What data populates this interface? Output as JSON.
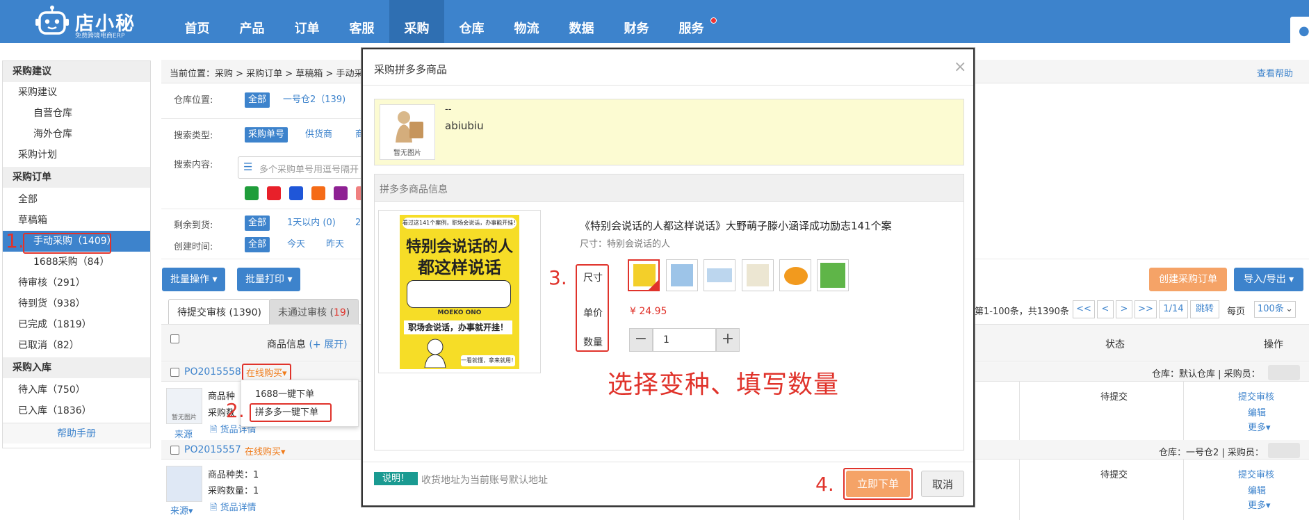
{
  "app": {
    "logo_text": "店小秘",
    "logo_sub": "免费跨境电商ERP"
  },
  "nav": [
    "首页",
    "产品",
    "订单",
    "客服",
    "采购",
    "仓库",
    "物流",
    "数据",
    "财务",
    "服务"
  ],
  "sidebar": {
    "items": [
      {
        "label": "采购建议",
        "level": 0
      },
      {
        "label": "采购建议",
        "level": 1
      },
      {
        "label": "自营仓库",
        "level": 2
      },
      {
        "label": "海外仓库",
        "level": 2
      },
      {
        "label": "采购计划",
        "level": 1
      },
      {
        "label": "采购订单",
        "level": 0
      },
      {
        "label": "全部",
        "level": 1
      },
      {
        "label": "草稿箱",
        "level": 1
      },
      {
        "label": "手动采购（1409）",
        "level": 2,
        "selected": true
      },
      {
        "label": "1688采购（84）",
        "level": 2
      },
      {
        "label": "待审核（291）",
        "level": 1
      },
      {
        "label": "待到货（938）",
        "level": 1
      },
      {
        "label": "已完成（1819）",
        "level": 1
      },
      {
        "label": "已取消（82）",
        "level": 1
      },
      {
        "label": "采购入库",
        "level": 0
      },
      {
        "label": "待入库（750）",
        "level": 1
      },
      {
        "label": "已入库（1836）",
        "level": 1
      }
    ],
    "help_link": "帮助手册"
  },
  "breadcrumb": "当前位置：采购 > 采购订单 > 草稿箱 > 手动采",
  "help": "查看帮助",
  "filters": {
    "warehouse_label": "仓库位置:",
    "warehouse_all": "全部",
    "warehouse_opt": "一号仓2（139)",
    "search_type_label": "搜索类型:",
    "search_type_opts": [
      "采购单号",
      "供货商",
      "商"
    ],
    "search_content_label": "搜索内容:",
    "search_placeholder": "多个采购单号用逗号隔开",
    "remaining_label": "剩余到货:",
    "remaining_all": "全部",
    "remaining_opts": [
      "1天以内 (0)",
      "2"
    ],
    "created_label": "创建时间:",
    "created_all": "全部",
    "created_opts": [
      "今天",
      "昨天"
    ],
    "color_tags": [
      "#1f9d3a",
      "#e8202a",
      "#1f56d8",
      "#f56b17",
      "#8e2193",
      "#f08080"
    ]
  },
  "actions": {
    "batch_op": "批量操作",
    "batch_print": "批量打印",
    "create_order": "创建采购订单",
    "import_export": "导入/导出"
  },
  "tabs": [
    {
      "label": "待提交审核 (1390)"
    },
    {
      "label": "未通过审核 (",
      "count": "19",
      "suffix": ")"
    }
  ],
  "pagination": {
    "summary": "第1-100条，共1390条",
    "buttons": [
      "<<",
      "<",
      ">",
      ">>"
    ],
    "page": "1/14",
    "jump": "跳转",
    "per_page_label": "每页",
    "per_page": "100条"
  },
  "table": {
    "col_product": "商品信息",
    "col_expand": "(+ 展开)",
    "col_status": "状态",
    "col_action": "操作"
  },
  "orders": [
    {
      "id": "PO2015558",
      "buy": "在线购买",
      "warehouse": "仓库：默认仓库 | 采购员：",
      "line1": "商品种",
      "line2": "采购数",
      "detail": "货品详情",
      "source": "来源",
      "thumb": "暂无图片",
      "status": "待提交",
      "ops": [
        "提交审核",
        "编辑",
        "更多"
      ]
    },
    {
      "id": "PO2015557",
      "buy": "在线购买",
      "warehouse": "仓库：一号仓2 | 采购员：",
      "line1": "商品种类：1",
      "line2": "采购数量：1",
      "detail": "货品详情",
      "source": "来源",
      "status": "待提交",
      "ops": [
        "提交审核",
        "编辑",
        "更多"
      ]
    }
  ],
  "dropdown": [
    "1688一键下单",
    "拼多多一键下单"
  ],
  "modal": {
    "title": "采购拼多多商品",
    "close": "×",
    "product_dash": "--",
    "product_name": "abiubiu",
    "no_image": "暂无图片",
    "section": "拼多多商品信息",
    "item_title": "《特别会说话的人都这样说话》大野萌子滕小涵译成功励志141个案",
    "spec": "尺寸：特别会说话的人",
    "size_label": "尺寸",
    "price_label": "单价",
    "qty_label": "数量",
    "price": "¥ 24.95",
    "qty": "1",
    "note_tag": "说明！",
    "note": "收货地址为当前账号默认地址",
    "submit": "立即下单",
    "cancel": "取消"
  },
  "book": {
    "top_banner": "看过这141个案例，职场会说话，办事能开挂！",
    "title_line1": "特别会说话的人",
    "title_line2": "都这样说话",
    "author": "MOEKO ONO",
    "slogan": "职场会说话，办事就开挂！",
    "footer": "一看就懂，拿来就用！"
  },
  "annotations": {
    "step1": "1.",
    "step2": "2.",
    "step3": "3.",
    "step4": "4.",
    "caption": "选择变种、填写数量"
  }
}
